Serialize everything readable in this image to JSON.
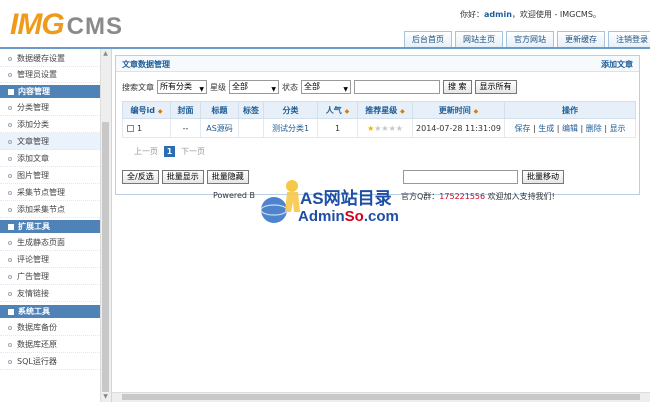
{
  "header": {
    "logo_img": "IMG",
    "logo_cms": "CMS",
    "welcome_prefix": "你好：",
    "user": "admin",
    "welcome_suffix": "，欢迎使用 - IMGCMS。",
    "nav": [
      "后台首页",
      "网站主页",
      "官方网站",
      "更新缓存",
      "注销登录"
    ]
  },
  "sidebar": {
    "items_top": [
      "数据缓存设置",
      "管理员设置"
    ],
    "group_content": "内容管理",
    "items_content": [
      "分类管理",
      "添加分类",
      "文章管理",
      "添加文章",
      "图片管理",
      "采集节点管理",
      "添加采集节点"
    ],
    "group_ext": "扩展工具",
    "items_ext": [
      "生成静态页面",
      "评论管理",
      "广告管理",
      "友情链接"
    ],
    "group_sys": "系统工具",
    "items_sys": [
      "数据库备份",
      "数据库还原",
      "SQL运行器"
    ]
  },
  "main": {
    "title": "文章数据管理",
    "add_link": "添加文章",
    "search": {
      "label": "搜索文章",
      "category": "所有分类",
      "star_label": "星级",
      "star": "全部",
      "status_label": "状态",
      "status": "全部",
      "search_btn": "搜 索",
      "show_all_btn": "显示所有"
    },
    "table": {
      "headers": [
        "编号id",
        "封面",
        "标题",
        "标签",
        "分类",
        "人气",
        "推荐星级",
        "更新时间",
        "操作"
      ],
      "row": {
        "id": "1",
        "cover": "--",
        "title": "AS源码",
        "tag": "",
        "category": "测试分类1",
        "views": "1",
        "time": "2014-07-28 11:31:09",
        "stars": 1,
        "ops": [
          "保存",
          "生成",
          "编辑",
          "删除",
          "显示"
        ]
      }
    },
    "pager": {
      "prev": "上一页",
      "current": "1",
      "next": "下一页"
    },
    "actions": [
      "全/反选",
      "批量显示",
      "批量隐藏"
    ],
    "move_btn": "批量移动"
  },
  "footer": {
    "powered": "Powered B",
    "qq_prefix": "官方Q群：",
    "qq": "175221556",
    "qq_suffix": " 欢迎加入支持我们!"
  },
  "watermark": {
    "line1": "AS网站目录",
    "line2a": "Admin",
    "line2b": "So",
    "line2c": ".com"
  }
}
